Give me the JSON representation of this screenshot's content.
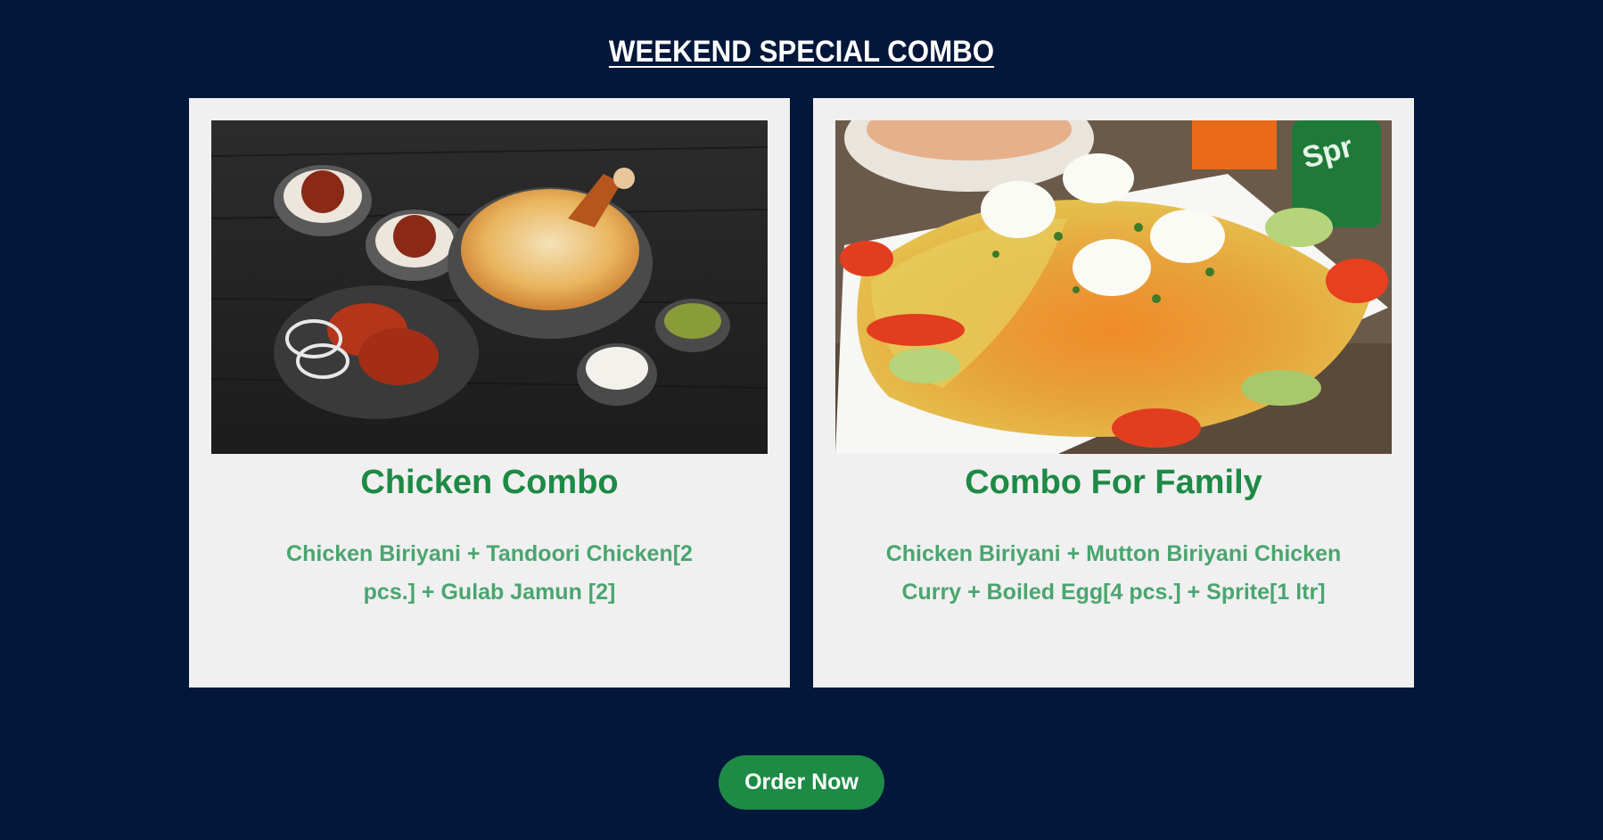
{
  "heading": "WEEKEND SPECIAL COMBO",
  "combos": [
    {
      "title": "Chicken Combo",
      "description": "Chicken Biriyani + Tandoori Chicken[2 pcs.] + Gulab Jamun [2]",
      "image_icon": "chicken-combo-photo"
    },
    {
      "title": "Combo For Family",
      "description": "Chicken Biriyani + Mutton Biriyani Chicken Curry + Boiled Egg[4 pcs.] + Sprite[1 ltr]",
      "image_icon": "family-combo-photo"
    }
  ],
  "cta": {
    "label": "Order Now"
  },
  "colors": {
    "background": "#02173a",
    "card": "#f0f0f0",
    "title_green": "#1d8a45",
    "text_green": "#4aa56f",
    "button": "#1d8a45"
  }
}
